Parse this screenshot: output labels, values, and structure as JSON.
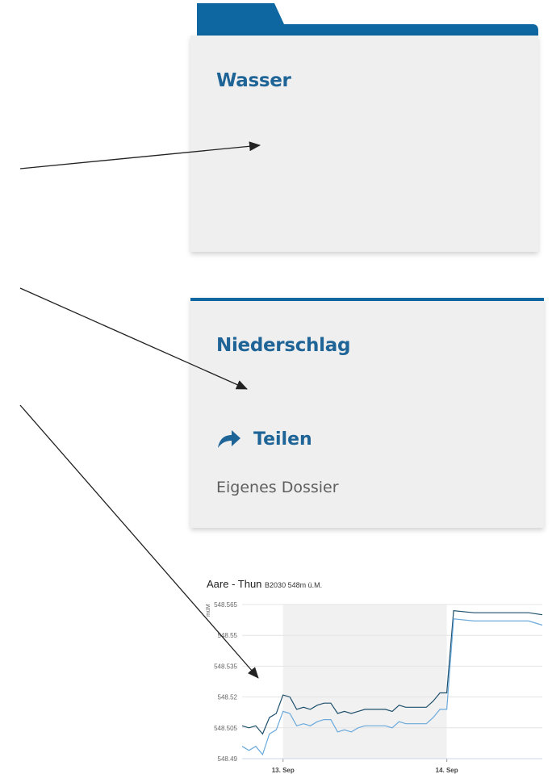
{
  "cards": {
    "wasser": {
      "title": "Wasser"
    },
    "niederschlag": {
      "title": "Niederschlag",
      "share_label": "Teilen",
      "dossier_label": "Eigenes Dossier"
    }
  },
  "colors": {
    "accent": "#0e67a0",
    "title": "#1f6497",
    "card_bg": "#efefef",
    "muted_text": "#5f5f5f"
  },
  "chart_title": {
    "main": "Aare - Thun",
    "sub": "B2030 548m  ü.M."
  },
  "chart_data": {
    "type": "line",
    "title": "Aare - Thun",
    "subtitle": "B2030 548m  ü.M.",
    "ylabel": "müM",
    "ylim": [
      548.49,
      548.565
    ],
    "yticks": [
      548.49,
      548.505,
      548.52,
      548.535,
      548.55,
      548.565
    ],
    "ytick_labels": [
      "548.49",
      "548.505",
      "548.52",
      "548.535",
      "548.55",
      "548.565"
    ],
    "xlim": [
      "2021-09-12T18:00",
      "2021-09-14T14:00"
    ],
    "xticks": [
      "2021-09-13T00:00",
      "2021-09-14T00:00"
    ],
    "xtick_labels": [
      "13. Sep",
      "14. Sep"
    ],
    "shaded_band": [
      "2021-09-13T00:00",
      "2021-09-14T00:00"
    ],
    "grid": true,
    "series": [
      {
        "color": "#1d4f6b",
        "x": [
          "2021-09-12T18:00",
          "2021-09-12T19:00",
          "2021-09-12T20:00",
          "2021-09-12T21:00",
          "2021-09-12T22:00",
          "2021-09-12T23:00",
          "2021-09-13T00:00",
          "2021-09-13T01:00",
          "2021-09-13T02:00",
          "2021-09-13T03:00",
          "2021-09-13T04:00",
          "2021-09-13T05:00",
          "2021-09-13T06:00",
          "2021-09-13T07:00",
          "2021-09-13T08:00",
          "2021-09-13T09:00",
          "2021-09-13T10:00",
          "2021-09-13T11:00",
          "2021-09-13T12:00",
          "2021-09-13T13:00",
          "2021-09-13T14:00",
          "2021-09-13T15:00",
          "2021-09-13T16:00",
          "2021-09-13T17:00",
          "2021-09-13T18:00",
          "2021-09-13T19:00",
          "2021-09-13T20:00",
          "2021-09-13T21:00",
          "2021-09-13T22:00",
          "2021-09-13T23:00",
          "2021-09-14T00:00",
          "2021-09-14T01:00",
          "2021-09-14T04:00",
          "2021-09-14T08:00",
          "2021-09-14T12:00",
          "2021-09-14T14:00"
        ],
        "y": [
          548.506,
          548.505,
          548.506,
          548.502,
          548.51,
          548.512,
          548.521,
          548.52,
          548.514,
          548.515,
          548.514,
          548.516,
          548.517,
          548.517,
          548.512,
          548.513,
          548.512,
          548.513,
          548.514,
          548.514,
          548.514,
          548.514,
          548.513,
          548.516,
          548.515,
          548.515,
          548.515,
          548.515,
          548.518,
          548.522,
          548.522,
          548.562,
          548.561,
          548.561,
          548.561,
          548.56
        ]
      },
      {
        "color": "#6aa9dc",
        "x": [
          "2021-09-12T18:00",
          "2021-09-12T19:00",
          "2021-09-12T20:00",
          "2021-09-12T21:00",
          "2021-09-12T22:00",
          "2021-09-12T23:00",
          "2021-09-13T00:00",
          "2021-09-13T01:00",
          "2021-09-13T02:00",
          "2021-09-13T03:00",
          "2021-09-13T04:00",
          "2021-09-13T05:00",
          "2021-09-13T06:00",
          "2021-09-13T07:00",
          "2021-09-13T08:00",
          "2021-09-13T09:00",
          "2021-09-13T10:00",
          "2021-09-13T11:00",
          "2021-09-13T12:00",
          "2021-09-13T13:00",
          "2021-09-13T14:00",
          "2021-09-13T15:00",
          "2021-09-13T16:00",
          "2021-09-13T17:00",
          "2021-09-13T18:00",
          "2021-09-13T19:00",
          "2021-09-13T20:00",
          "2021-09-13T21:00",
          "2021-09-13T22:00",
          "2021-09-13T23:00",
          "2021-09-14T00:00",
          "2021-09-14T01:00",
          "2021-09-14T04:00",
          "2021-09-14T08:00",
          "2021-09-14T12:00",
          "2021-09-14T14:00"
        ],
        "y": [
          548.496,
          548.494,
          548.496,
          548.492,
          548.502,
          548.504,
          548.513,
          548.512,
          548.506,
          548.507,
          548.506,
          548.508,
          548.509,
          548.509,
          548.503,
          548.504,
          548.503,
          548.505,
          548.506,
          548.506,
          548.506,
          548.506,
          548.505,
          548.508,
          548.507,
          548.507,
          548.507,
          548.507,
          548.51,
          548.514,
          548.514,
          548.558,
          548.557,
          548.557,
          548.557,
          548.555
        ]
      }
    ]
  }
}
